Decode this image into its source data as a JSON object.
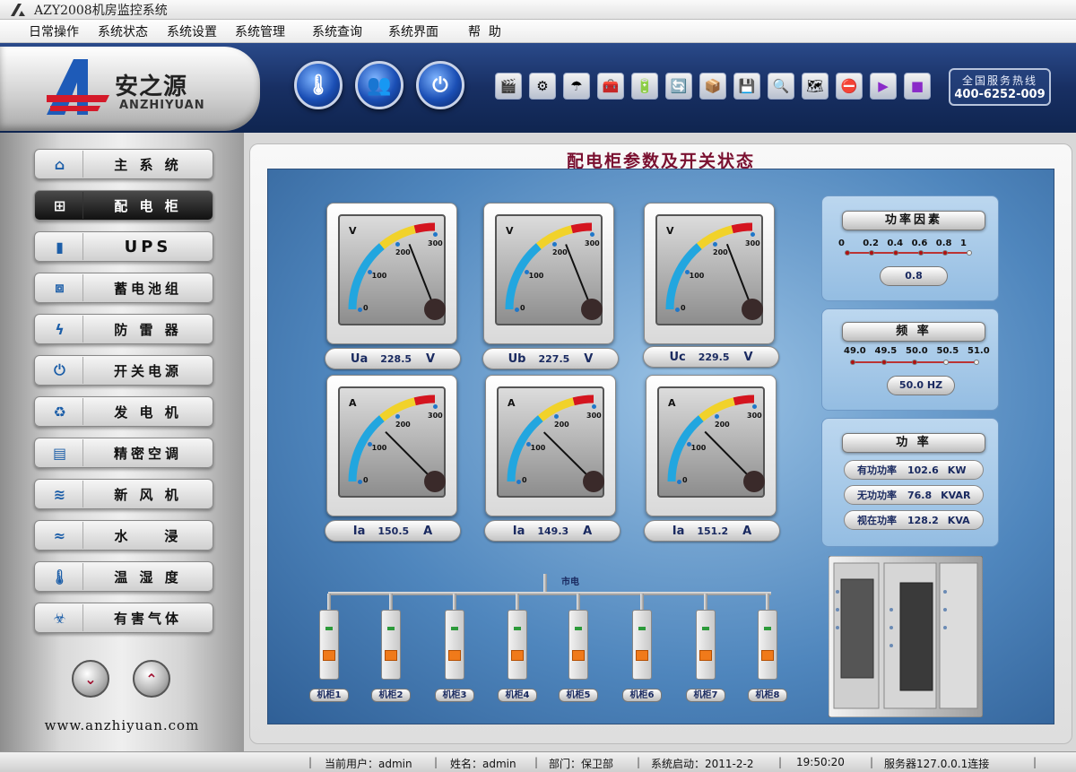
{
  "window": {
    "title": "AZY2008机房监控系统"
  },
  "menu": [
    "日常操作",
    "系统状态",
    "系统设置",
    "系统管理",
    "系统查询",
    "系统界面",
    "帮  助"
  ],
  "brand": {
    "cn": "安之源",
    "en": "ANZHIYUAN"
  },
  "hotline": {
    "title": "全国服务热线",
    "number": "400-6252-009"
  },
  "sidebar": {
    "items": [
      {
        "label": "主 系 统",
        "icon": "home-icon",
        "active": false
      },
      {
        "label": "配 电 柜",
        "icon": "network-icon",
        "active": true
      },
      {
        "label": "UPS",
        "icon": "ups-icon",
        "active": false
      },
      {
        "label": "蓄电池组",
        "icon": "battery-icon",
        "active": false
      },
      {
        "label": "防 雷 器",
        "icon": "lightning-icon",
        "active": false
      },
      {
        "label": "开关电源",
        "icon": "power-icon",
        "active": false
      },
      {
        "label": "发 电 机",
        "icon": "generator-icon",
        "active": false
      },
      {
        "label": "精密空调",
        "icon": "ac-icon",
        "active": false
      },
      {
        "label": "新 风 机",
        "icon": "fan-icon",
        "active": false
      },
      {
        "label": "水    浸",
        "icon": "water-icon",
        "active": false
      },
      {
        "label": "温 湿 度",
        "icon": "thermometer-icon",
        "active": false
      },
      {
        "label": "有害气体",
        "icon": "gas-icon",
        "active": false
      }
    ],
    "website": "www.anzhiyuan.com"
  },
  "main": {
    "title": "配电柜参数及开关状态",
    "gauges": [
      {
        "unit": "V",
        "name": "Ua",
        "value": "228.5",
        "value_unit": "V",
        "reading": 228.5,
        "ticks": [
          "0",
          "100",
          "200",
          "300"
        ]
      },
      {
        "unit": "V",
        "name": "Ub",
        "value": "227.5",
        "value_unit": "V",
        "reading": 227.5,
        "ticks": [
          "0",
          "100",
          "200",
          "300"
        ]
      },
      {
        "unit": "V",
        "name": "Uc",
        "value": "229.5",
        "value_unit": "V",
        "reading": 229.5,
        "ticks": [
          "0",
          "100",
          "200",
          "300"
        ]
      },
      {
        "unit": "A",
        "name": "Ia",
        "value": "150.5",
        "value_unit": "A",
        "reading": 150.5,
        "ticks": [
          "0",
          "100",
          "200",
          "300"
        ]
      },
      {
        "unit": "A",
        "name": "Ia",
        "value": "149.3",
        "value_unit": "A",
        "reading": 149.3,
        "ticks": [
          "0",
          "100",
          "200",
          "300"
        ]
      },
      {
        "unit": "A",
        "name": "Ia",
        "value": "151.2",
        "value_unit": "A",
        "reading": 151.2,
        "ticks": [
          "0",
          "100",
          "200",
          "300"
        ]
      }
    ],
    "power_factor": {
      "title": "功率因素",
      "scale": [
        "0",
        "0.2",
        "0.4",
        "0.6",
        "0.8",
        "1"
      ],
      "value": "0.8",
      "level": 0.8
    },
    "frequency": {
      "title": "频  率",
      "scale": [
        "49.0",
        "49.5",
        "50.0",
        "50.5",
        "51.0"
      ],
      "value": "50.0 HZ",
      "level": 50.0
    },
    "power": {
      "title": "功  率",
      "rows": [
        {
          "label": "有功功率",
          "value": "102.6",
          "unit": "KW"
        },
        {
          "label": "无功功率",
          "value": "76.8",
          "unit": "KVAR"
        },
        {
          "label": "视在功率",
          "value": "128.2",
          "unit": "KVA"
        }
      ]
    },
    "mains_label": "市电",
    "breakers": [
      "机柜1",
      "机柜2",
      "机柜3",
      "机柜4",
      "机柜5",
      "机柜6",
      "机柜7",
      "机柜8"
    ]
  },
  "status": {
    "user": "当前用户：admin",
    "name": "姓名：admin",
    "dept": "部门：保卫部",
    "start": "系统启动：2011-2-2",
    "time": "19:50:20",
    "server": "服务器127.0.0.1连接"
  },
  "colors": {
    "accent": "#1b4fb5",
    "title": "#7a1030",
    "panel": "#4f86bd"
  }
}
